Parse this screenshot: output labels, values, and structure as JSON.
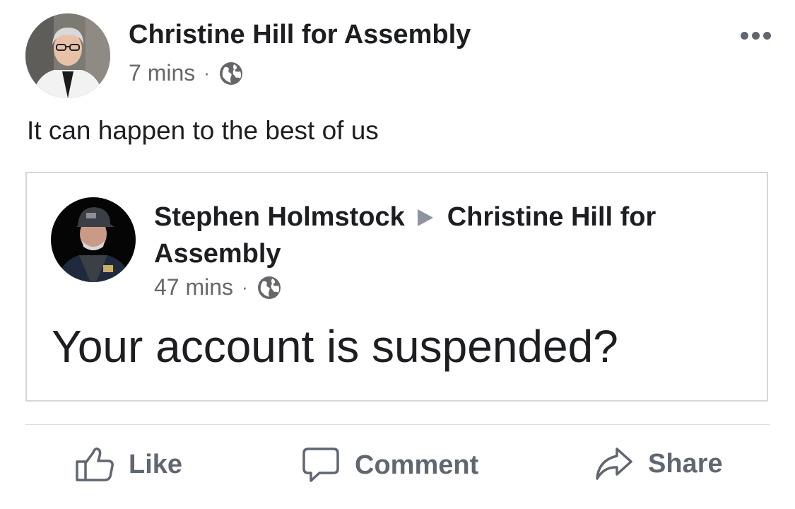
{
  "post": {
    "author": "Christine Hill for Assembly",
    "time": "7 mins",
    "separator": "·",
    "audience_icon": "globe-icon",
    "more_icon": "more-horizontal-icon",
    "text": "It can happen to the best of us"
  },
  "shared_post": {
    "author": "Stephen Holmstock",
    "arrow_icon": "triangle-right-icon",
    "target": "Christine Hill for Assembly",
    "time": "47 mins",
    "separator": "·",
    "audience_icon": "globe-icon",
    "text": "Your account is suspended?"
  },
  "actions": {
    "like": {
      "label": "Like",
      "icon": "thumbs-up-icon"
    },
    "comment": {
      "label": "Comment",
      "icon": "comment-bubble-icon"
    },
    "share": {
      "label": "Share",
      "icon": "share-arrow-icon"
    }
  },
  "colors": {
    "text_primary": "#1c1e21",
    "text_secondary": "#65676b",
    "action_gray": "#606770",
    "border": "#d4d6da"
  }
}
